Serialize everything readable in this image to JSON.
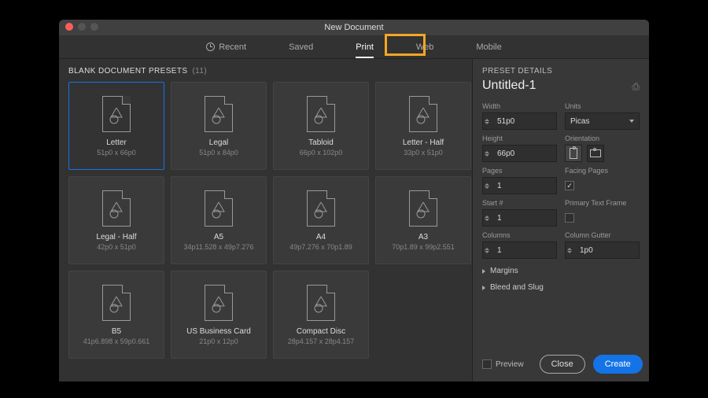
{
  "window": {
    "title": "New Document"
  },
  "tabs": {
    "recent": "Recent",
    "saved": "Saved",
    "print": "Print",
    "web": "Web",
    "mobile": "Mobile",
    "active": "print"
  },
  "presets_header": {
    "label": "BLANK DOCUMENT PRESETS",
    "count": "(11)"
  },
  "presets": [
    {
      "name": "Letter",
      "dims": "51p0 x 66p0",
      "selected": true
    },
    {
      "name": "Legal",
      "dims": "51p0 x 84p0"
    },
    {
      "name": "Tabloid",
      "dims": "66p0 x 102p0"
    },
    {
      "name": "Letter - Half",
      "dims": "33p0 x 51p0"
    },
    {
      "name": "Legal - Half",
      "dims": "42p0 x 51p0"
    },
    {
      "name": "A5",
      "dims": "34p11.528 x 49p7.276"
    },
    {
      "name": "A4",
      "dims": "49p7.276 x 70p1.89"
    },
    {
      "name": "A3",
      "dims": "70p1.89 x 99p2.551"
    },
    {
      "name": "B5",
      "dims": "41p6.898 x 59p0.661"
    },
    {
      "name": "US Business Card",
      "dims": "21p0 x 12p0"
    },
    {
      "name": "Compact Disc",
      "dims": "28p4.157 x 28p4.157"
    }
  ],
  "details": {
    "section_title": "PRESET DETAILS",
    "doc_name": "Untitled-1",
    "width_label": "Width",
    "width": "51p0",
    "units_label": "Units",
    "units": "Picas",
    "height_label": "Height",
    "height": "66p0",
    "orientation_label": "Orientation",
    "pages_label": "Pages",
    "pages": "1",
    "facing_label": "Facing Pages",
    "facing_checked": true,
    "start_label": "Start #",
    "start": "1",
    "ptf_label": "Primary Text Frame",
    "ptf_checked": false,
    "columns_label": "Columns",
    "columns": "1",
    "gutter_label": "Column Gutter",
    "gutter": "1p0",
    "margins_label": "Margins",
    "bleed_label": "Bleed and Slug"
  },
  "footer": {
    "preview": "Preview",
    "close": "Close",
    "create": "Create"
  }
}
